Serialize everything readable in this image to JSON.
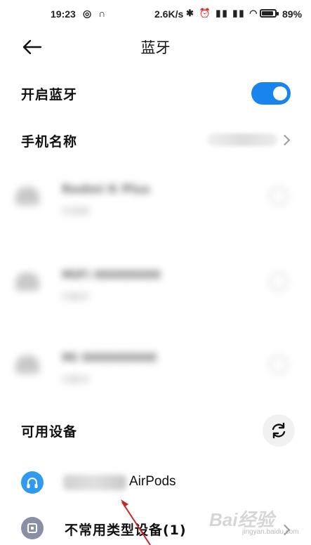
{
  "status_bar": {
    "time": "19:23",
    "left_icons": "◎ ∩",
    "speed": "2.6K/s",
    "right_icons": "✱ ⏰ ▮▮ ▮▮ ◠",
    "battery_level": 0.89,
    "battery_text": "89%"
  },
  "header": {
    "back_icon": "arrow-left-icon",
    "title": "蓝牙"
  },
  "bluetooth_toggle": {
    "label": "开启蓝牙",
    "enabled": true,
    "accent_color": "#1a84ee"
  },
  "phone_name": {
    "label": "手机名称"
  },
  "paired_devices": [
    {
      "name": "Redmi K Plus",
      "status": "已连接"
    },
    {
      "name": "MiFi 00000000",
      "status": "已配对"
    },
    {
      "name": "Mi 000000000",
      "status": "已配对"
    }
  ],
  "available_section": {
    "label": "可用设备",
    "refresh_icon": "refresh-icon"
  },
  "available_devices": [
    {
      "name": "AirPods",
      "icon": "headphones-icon",
      "icon_color": "#2f9bf0"
    },
    {
      "name": "不常用类型设备(1)",
      "icon": "device-icon",
      "icon_color": "#8a8fa8"
    }
  ],
  "watermark": {
    "text": "Bai经验",
    "sub": "jingyan.baidu.com"
  }
}
